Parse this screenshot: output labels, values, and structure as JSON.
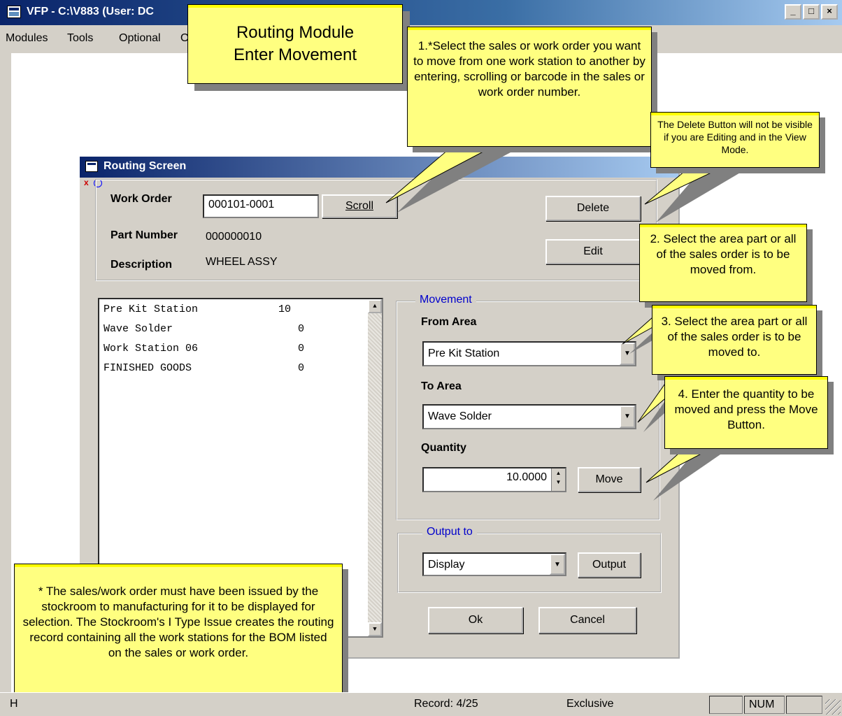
{
  "app": {
    "title": "VFP - C:\\V883  (User: DC",
    "window_buttons": [
      "_",
      "□",
      "×"
    ]
  },
  "menu": [
    "Modules",
    "Tools",
    "Optional",
    "O"
  ],
  "routing_screen": {
    "title": "Routing Screen",
    "work_order_label": "Work Order",
    "work_order_value": "000101-0001",
    "scroll_label": "Scroll",
    "part_number_label": "Part Number",
    "part_number_value": "000000010",
    "description_label": "Description",
    "description_value": "WHEEL ASSY",
    "delete_label": "Delete",
    "edit_label": "Edit",
    "stations": [
      {
        "name": "Pre Kit Station",
        "qty": "10"
      },
      {
        "name": "Wave Solder",
        "qty": "0"
      },
      {
        "name": "Work Station 06",
        "qty": "0"
      },
      {
        "name": "FINISHED GOODS",
        "qty": "0"
      }
    ],
    "movement": {
      "group_label": "Movement",
      "from_area_label": "From Area",
      "from_area_value": "Pre Kit Station",
      "to_area_label": "To Area",
      "to_area_value": "Wave Solder",
      "quantity_label": "Quantity",
      "quantity_value": "10.0000",
      "move_label": "Move"
    },
    "output": {
      "group_label": "Output to",
      "value": "Display",
      "button_label": "Output"
    },
    "ok_label": "Ok",
    "cancel_label": "Cancel"
  },
  "callouts": {
    "title_line1": "Routing Module",
    "title_line2": "Enter Movement",
    "step1": "1.*Select the sales or work order you want to move from one work station to another by entering, scrolling or barcode in the sales or work order number.",
    "delete_note": "The Delete Button will not be visible if you are Editing and in the View Mode.",
    "step2": "2. Select the area part or all of the sales order is to be moved from.",
    "step3": "3. Select the area part or all of the sales order is to be moved to.",
    "step4": "4. Enter the quantity to be moved and press the Move Button.",
    "footnote": "* The sales/work order must have been issued by the stockroom to manufacturing for it to be displayed for selection.  The Stockroom's I Type Issue creates the routing record containing all the work stations for the BOM listed on the sales or work order."
  },
  "statusbar": {
    "left": "H",
    "record": "Record: 4/25",
    "mode": "Exclusive",
    "num": "NUM"
  }
}
